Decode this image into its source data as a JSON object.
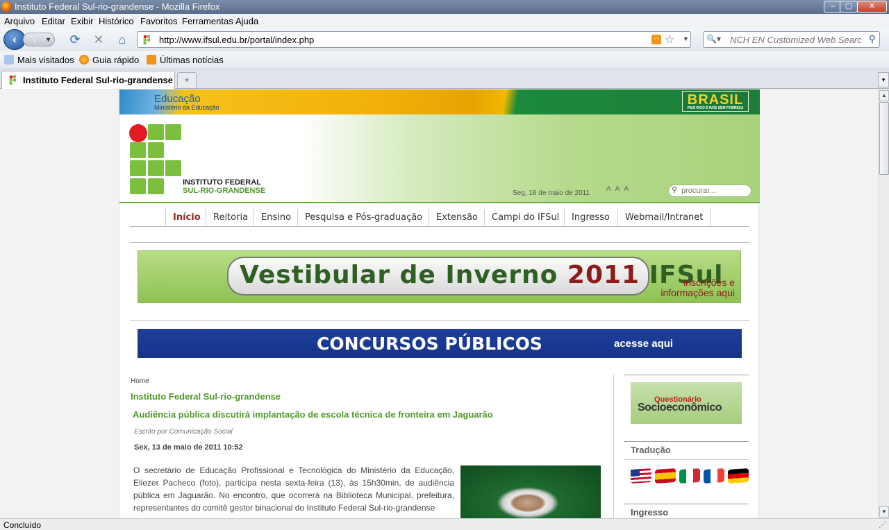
{
  "window": {
    "title": "Instituto Federal Sul-rio-grandense - Mozilla Firefox",
    "minimize": "–",
    "maximize": "▢",
    "close": "✕"
  },
  "menu": [
    "Arquivo",
    "Editar",
    "Exibir",
    "Histórico",
    "Favoritos",
    "Ferramentas",
    "Ajuda"
  ],
  "toolbar": {
    "url": "http://www.ifsul.edu.br/portal/index.php",
    "search_placeholder": "NCH EN Customized Web Search"
  },
  "bookmarks": [
    "Mais visitados",
    "Guia rápido",
    "Últimas notícias"
  ],
  "tab": {
    "label": "Instituto Federal Sul-rio-grandense",
    "new_tab": "+"
  },
  "site": {
    "gov_edu": "Educação",
    "gov_mec": "Ministério da Educação",
    "brasil": "BRASIL",
    "brasil_tag": "PAÍS RICO É PAÍS SEM POBREZA",
    "logo_line1": "INSTITUTO FEDERAL",
    "logo_line2": "SUL-RIO-GRANDENSE",
    "date": "Seg, 16 de maio de 2011",
    "font_sizes": "AAA",
    "search_placeholder": "procurar...",
    "nav": [
      "Início",
      "Reitoria",
      "Ensino",
      "Pesquisa e Pós-graduação",
      "Extensão",
      "Campi do IFSul",
      "Ingresso",
      "Webmail/Intranet"
    ],
    "banner_vest": {
      "title_a": "Vestibular de Inverno ",
      "title_year": "2011",
      "title_b": " IFSul",
      "sub1": "inscrições e",
      "sub2": "informações aqui"
    },
    "banner_concursos": {
      "title": "CONCURSOS PÚBLICOS",
      "cta": "acesse aqui"
    },
    "breadcrumb": "Home",
    "site_title": "Instituto Federal Sul-rio-grandense",
    "headline": "Audiência pública discutirá implantação de escola técnica de fronteira em Jaguarão",
    "author": "Escrito por Comunicação Social",
    "dateline": "Sex, 13 de maio de 2011 10:52",
    "body": "O secretário de Educação Profissional e Tecnológica do Ministério da Educação, Eliezer Pacheco (foto), participa nesta sexta-feira (13), às 15h30min, de audiência pública em Jaguarão. No encontro, que ocorrerá na Biblioteca Municipal, prefeitura, representantes do comitê gestor binacional do Instituto Federal Sul-rio-grandense"
  },
  "sidebar": {
    "quest_top": "Questionário",
    "quest_main": "Socioeconômico",
    "traducao": "Tradução",
    "ingresso": "Ingresso",
    "flags": [
      "us-flag-icon",
      "es-flag-icon",
      "it-flag-icon",
      "fr-flag-icon",
      "de-flag-icon"
    ]
  },
  "status": "Concluído"
}
